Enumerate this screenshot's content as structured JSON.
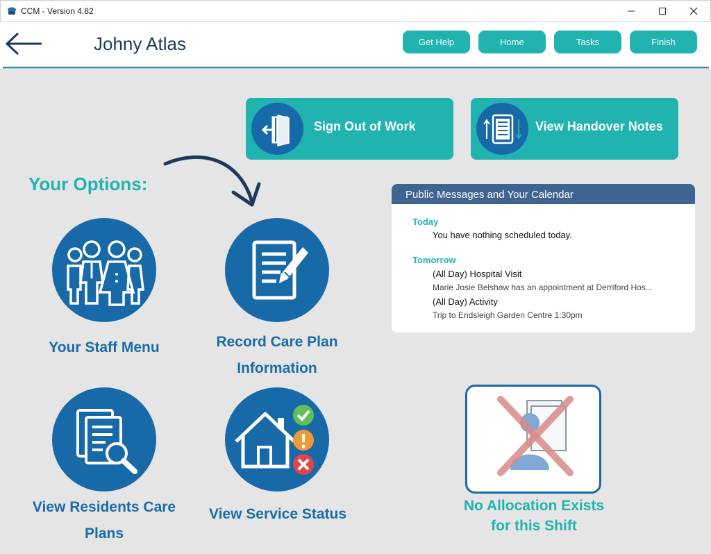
{
  "window": {
    "title": "CCM - Version 4.82",
    "min_icon": "minimize-icon",
    "max_icon": "maximize-icon",
    "close_icon": "close-icon"
  },
  "header": {
    "user_name": "Johny Atlas",
    "back_icon": "back-arrow-icon",
    "buttons": [
      "Get Help",
      "Home",
      "Tasks",
      "Finish"
    ]
  },
  "actions": {
    "sign_out": "Sign Out of Work",
    "handover": "View Handover Notes"
  },
  "options": {
    "title": "Your Options:",
    "tiles": [
      {
        "label_lines": [
          "Your Staff Menu"
        ],
        "icon": "staff-group-icon"
      },
      {
        "label_lines": [
          "Record Care Plan",
          "Information"
        ],
        "icon": "care-plan-edit-icon"
      },
      {
        "label_lines": [
          "View Residents Care",
          "Plans"
        ],
        "icon": "documents-search-icon"
      },
      {
        "label_lines": [
          "View Service Status"
        ],
        "icon": "service-status-house-icon"
      }
    ]
  },
  "calendar": {
    "header": "Public Messages and Your Calendar",
    "today_label": "Today",
    "today_text": "You have nothing scheduled today.",
    "tomorrow_label": "Tomorrow",
    "events": [
      {
        "title": "(All Day) Hospital Visit",
        "detail": "Marie Josie Belshaw has an appointment at Derriford Hos..."
      },
      {
        "title": "(All Day) Activity",
        "detail": "Trip to Endsleigh Garden Centre 1:30pm"
      }
    ]
  },
  "allocation": {
    "lines": [
      "No Allocation Exists",
      "for this Shift"
    ],
    "icon": "no-allocation-icon"
  },
  "colors": {
    "teal": "#20b3b0",
    "blue": "#1769a8",
    "navy": "#3f6491",
    "background": "#e5e5e5"
  }
}
